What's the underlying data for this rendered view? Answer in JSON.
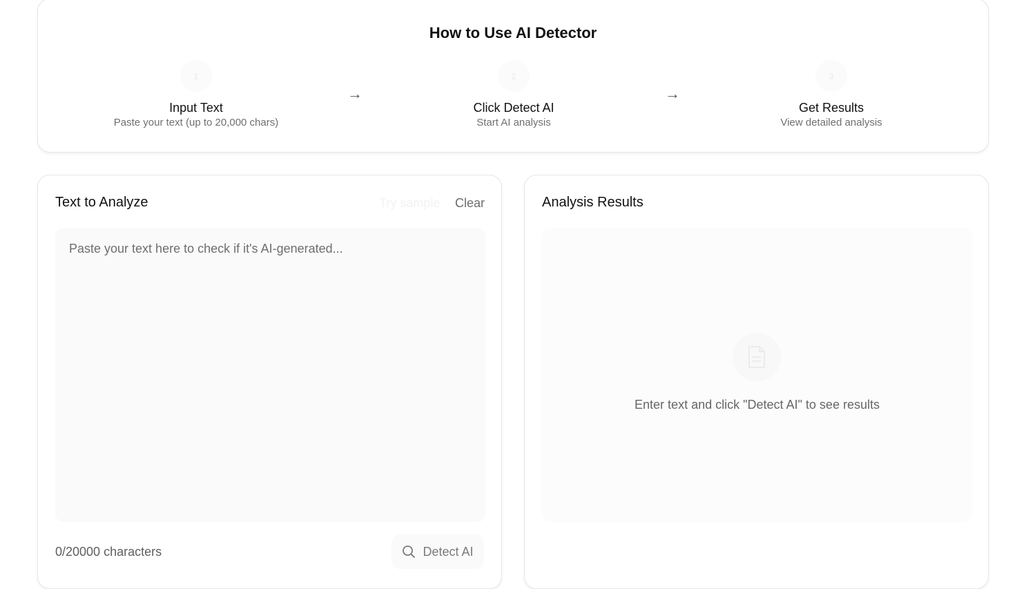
{
  "howto": {
    "title": "How to Use AI Detector",
    "steps": [
      {
        "number": "1",
        "title": "Input Text",
        "description": "Paste your text (up to 20,000 chars)"
      },
      {
        "number": "2",
        "title": "Click Detect AI",
        "description": "Start AI analysis"
      },
      {
        "number": "3",
        "title": "Get Results",
        "description": "View detailed analysis"
      }
    ],
    "arrow": "→"
  },
  "input_panel": {
    "title": "Text to Analyze",
    "try_sample_label": "Try sample",
    "clear_label": "Clear",
    "placeholder": "Paste your text here to check if it's AI-generated...",
    "value": "",
    "char_count": "0/20000 characters",
    "detect_label": "Detect AI"
  },
  "results_panel": {
    "title": "Analysis Results",
    "empty_message": "Enter text and click \"Detect AI\" to see results"
  }
}
